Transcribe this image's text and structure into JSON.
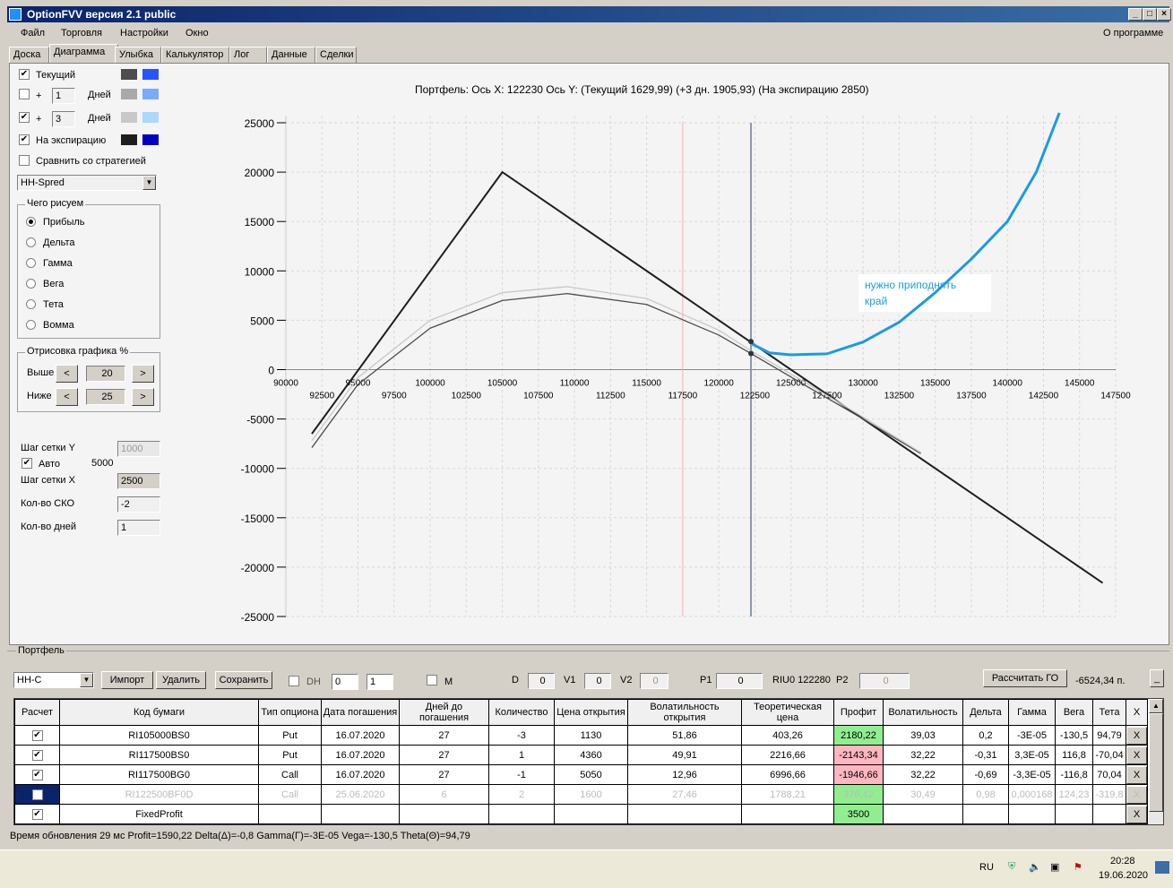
{
  "window": {
    "title": "OptionFVV версия 2.1 public"
  },
  "menu": {
    "items": [
      "Файл",
      "Торговля",
      "Настройки",
      "Окно"
    ],
    "about": "О программе"
  },
  "tabs": [
    "Доска",
    "Диаграмма",
    "Улыбка",
    "Калькулятор",
    "Лог",
    "Данные",
    "Сделки"
  ],
  "active_tab": "Диаграмма",
  "left_panel": {
    "series": [
      {
        "label": "Текущий",
        "checked": true,
        "colors": [
          "#4d4d4d",
          "#2a52ff"
        ]
      },
      {
        "label": "Дней",
        "prefix": "+",
        "days": "1",
        "checked": false,
        "colors": [
          "#a9a9a9",
          "#7aaaff"
        ]
      },
      {
        "label": "Дней",
        "prefix": "+",
        "days": "3",
        "checked": true,
        "colors": [
          "#c8c8c8",
          "#aad8ff"
        ]
      },
      {
        "label": "На экспирацию",
        "checked": true,
        "colors": [
          "#1e1e1e",
          "#0000c0"
        ]
      }
    ],
    "compare": {
      "label": "Сравнить со стратегией",
      "checked": false
    },
    "strategy_select": "НН-Spred",
    "draw_group": {
      "title": "Чего рисуем",
      "options": [
        "Прибыль",
        "Дельта",
        "Гамма",
        "Вега",
        "Тета",
        "Вомма"
      ],
      "selected": "Прибыль"
    },
    "range_group": {
      "title": "Отрисовка графика %",
      "above_label": "Выше",
      "above": "20",
      "below_label": "Ниже",
      "below": "25",
      "prev": "<",
      "next": ">"
    },
    "grid_y_label": "Шаг сетки Y",
    "grid_y": "1000",
    "auto_label": "Авто",
    "auto_checked": true,
    "auto_value": "5000",
    "grid_x_label": "Шаг сетки X",
    "grid_x": "2500",
    "sko_label": "Кол-во СКО",
    "sko": "-2",
    "days_label": "Кол-во дней",
    "days": "1"
  },
  "chart_data": {
    "type": "line",
    "title": "Портфель:  Ось X:  122230  Ось Y:   (Текущий 1629,99)   (+3 дн.  1905,93)   (На экспирацию 2850)",
    "xlim": [
      90000,
      147500
    ],
    "ylim": [
      -25000,
      25000
    ],
    "grid": true,
    "x_ticks_upper": [
      90000,
      95000,
      100000,
      105000,
      110000,
      115000,
      120000,
      125000,
      130000,
      135000,
      140000,
      145000
    ],
    "x_ticks_lower": [
      92500,
      97500,
      102500,
      107500,
      112500,
      117500,
      122500,
      127500,
      132500,
      137500,
      142500,
      147500
    ],
    "y_ticks": [
      25000,
      20000,
      15000,
      10000,
      5000,
      0,
      -5000,
      -10000,
      -15000,
      -20000,
      -25000
    ],
    "vlines": [
      {
        "x": 117500,
        "color": "#ffb0b0"
      },
      {
        "x": 122230,
        "color": "#8899aa"
      }
    ],
    "series": [
      {
        "key": "expiration",
        "color": "#1e1e1e",
        "points": [
          [
            91800,
            -6500
          ],
          [
            105000,
            20000
          ],
          [
            146600,
            -21600
          ]
        ]
      },
      {
        "key": "current",
        "color": "#4d4d4d",
        "points": [
          [
            91800,
            -7900
          ],
          [
            95000,
            -1500
          ],
          [
            100000,
            4200
          ],
          [
            105000,
            7000
          ],
          [
            109500,
            7700
          ],
          [
            115000,
            6600
          ],
          [
            120000,
            3500
          ],
          [
            122230,
            1630
          ],
          [
            126000,
            -1600
          ],
          [
            130000,
            -5000
          ],
          [
            134000,
            -8500
          ]
        ]
      },
      {
        "key": "plus3",
        "color": "#c8c8c8",
        "points": [
          [
            91800,
            -7200
          ],
          [
            95000,
            -800
          ],
          [
            100000,
            5000
          ],
          [
            105000,
            7800
          ],
          [
            109500,
            8400
          ],
          [
            115000,
            7200
          ],
          [
            120000,
            4000
          ],
          [
            122230,
            1906
          ],
          [
            126000,
            -1300
          ],
          [
            130000,
            -4800
          ],
          [
            134000,
            -8400
          ]
        ]
      },
      {
        "key": "annotation",
        "color": "#1a9be0",
        "points": [
          [
            122300,
            2600
          ],
          [
            123500,
            1700
          ],
          [
            125000,
            1500
          ],
          [
            127500,
            1600
          ],
          [
            130000,
            2800
          ],
          [
            132500,
            4800
          ],
          [
            135000,
            7800
          ],
          [
            137500,
            11200
          ],
          [
            140000,
            15000
          ],
          [
            142000,
            20000
          ],
          [
            143600,
            26000
          ]
        ]
      }
    ],
    "markers": [
      [
        122230,
        2850
      ],
      [
        122230,
        1630
      ]
    ],
    "annotation_text": [
      "нужно приподнять",
      "край"
    ]
  },
  "portfolio": {
    "title": "Портфель",
    "select": "НН-С",
    "import": "Импорт",
    "delete": "Удалить",
    "save": "Сохранить",
    "dh_label": "DH",
    "spin1": "0",
    "spin2": "1",
    "m_label": "M",
    "d_label": "D",
    "d": "0",
    "v1_label": "V1",
    "v1": "0",
    "v2_label": "V2",
    "v2": "0",
    "p1_label": "P1",
    "p1": "0",
    "ticker": "RIU0 122280",
    "p2_label": "P2",
    "p2": "0",
    "calc_go": "Рассчитать ГО",
    "go_value": "-6524,34 п.",
    "min_btn": "_",
    "columns": [
      "Расчет",
      "Код бумаги",
      "Тип опциона",
      "Дата погашения",
      "Дней до погашения",
      "Количество",
      "Цена открытия",
      "Волатильность открытия",
      "Теоретическая цена",
      "Профит",
      "Волатильность",
      "Дельта",
      "Гамма",
      "Вега",
      "Тета",
      "X"
    ],
    "rows": [
      {
        "checked": true,
        "cells": [
          "RI105000BS0",
          "Put",
          "16.07.2020",
          "27",
          "-3",
          "1130",
          "51,86",
          "403,26",
          "2180,22",
          "39,03",
          "0,2",
          "-3E-05",
          "-130,5",
          "94,79"
        ],
        "profit": "green"
      },
      {
        "checked": true,
        "cells": [
          "RI117500BS0",
          "Put",
          "16.07.2020",
          "27",
          "1",
          "4360",
          "49,91",
          "2216,66",
          "-2143,34",
          "32,22",
          "-0,31",
          "3,3E-05",
          "116,8",
          "-70,04"
        ],
        "profit": "pink"
      },
      {
        "checked": true,
        "cells": [
          "RI117500BG0",
          "Call",
          "16.07.2020",
          "27",
          "-1",
          "5050",
          "12,96",
          "6996,66",
          "-1946,66",
          "32,22",
          "-0,69",
          "-3,3E-05",
          "-116,8",
          "70,04"
        ],
        "profit": "pink"
      },
      {
        "checked": false,
        "disabled": true,
        "cells": [
          "RI122500BF0D",
          "Call",
          "25.06.2020",
          "6",
          "2",
          "1600",
          "27,46",
          "1788,21",
          "376,42",
          "30,49",
          "0,98",
          "0,000168",
          "124,23",
          "-319,8"
        ],
        "profit": "green"
      },
      {
        "checked": true,
        "cells": [
          "FixedProfit",
          "",
          "",
          "",
          "",
          "",
          "",
          "",
          "3500",
          "",
          "",
          "",
          "",
          ""
        ],
        "profit": "green"
      }
    ],
    "delete_glyph": "X"
  },
  "status": "Время обновления 29 мс  Profit=1590,22 Delta(Δ)=-0,8 Gamma(Γ)=-3E-05 Vega=-130,5 Theta(Θ)=94,79",
  "taskbar": {
    "lang": "RU",
    "time": "20:28",
    "date": "19.06.2020"
  }
}
